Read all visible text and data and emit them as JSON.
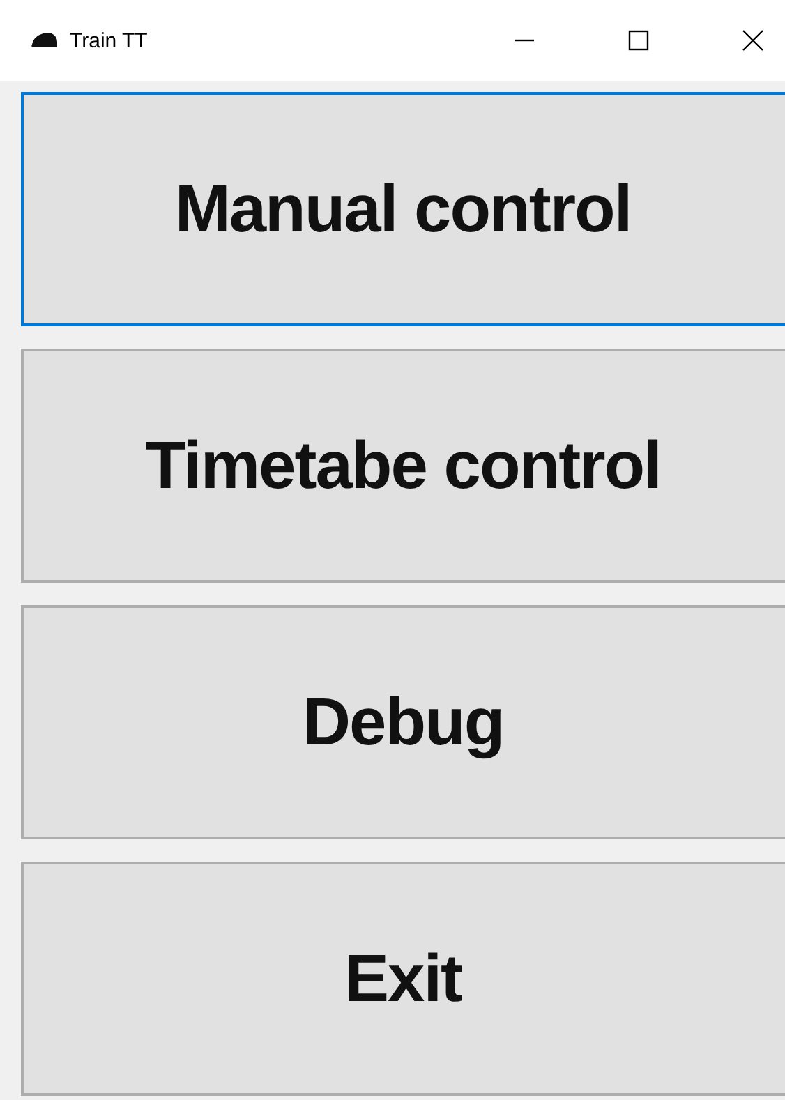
{
  "window": {
    "title": "Train TT"
  },
  "buttons": [
    {
      "label": "Manual control",
      "focused": true
    },
    {
      "label": "Timetabe control",
      "focused": false
    },
    {
      "label": "Debug",
      "focused": false
    },
    {
      "label": "Exit",
      "focused": false
    }
  ]
}
